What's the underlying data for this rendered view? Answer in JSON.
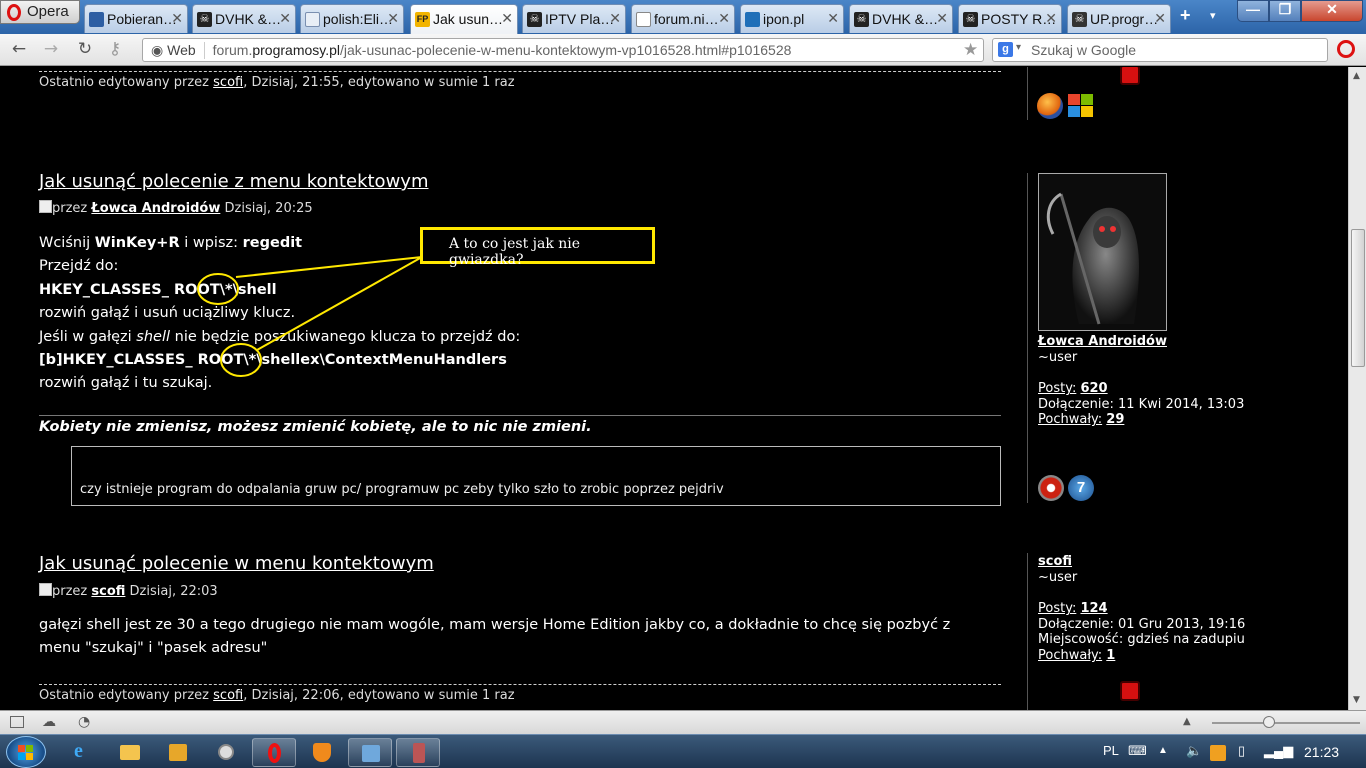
{
  "browser": {
    "menu_label": "Opera",
    "tabs": [
      {
        "label": "Pobieran…"
      },
      {
        "label": "DVHK &…"
      },
      {
        "label": "polish:Eli…"
      },
      {
        "label": "Jak usun…"
      },
      {
        "label": "IPTV Pla…"
      },
      {
        "label": "forum.ni…"
      },
      {
        "label": "ipon.pl"
      },
      {
        "label": "DVHK &…"
      },
      {
        "label": "POSTY R…"
      },
      {
        "label": "UP.progr…"
      }
    ],
    "address": {
      "badge": "Web",
      "url_prefix": "forum.",
      "url_domain": "programosy.pl",
      "url_path": "/jak-usunac-polecenie-w-menu-kontektowym-vp1016528.html#p1016528"
    },
    "search_placeholder": "Szukaj w Google"
  },
  "posts": [
    {
      "edited_prefix": "Ostatnio edytowany przez",
      "edited_user": "scofi",
      "edited_suffix": ", Dzisiaj, 21:55, edytowano w sumie 1 raz"
    },
    {
      "title": "Jak usunąć polecenie z menu kontektowym",
      "by": "przez",
      "author": "Łowca Androidów",
      "date": "Dzisiaj, 20:25",
      "lines": {
        "l1a": "Wciśnij ",
        "l1b": "WinKey+R",
        "l1c": " i wpisz: ",
        "l1d": "regedit",
        "l2": "Przejdź do:",
        "l3": "HKEY_CLASSES_ ROOT\\*\\shell",
        "l4": "rozwiń gałąź i usuń uciążliwy klucz.",
        "l5a": "Jeśli w gałęzi ",
        "l5b": "shell",
        "l5c": " nie będzie poszukiwanego klucza to przejdź do:",
        "l6": "[b]HKEY_CLASSES_ ROOT\\*\\shellex\\ContextMenuHandlers",
        "l7": "rozwiń gałąź i tu szukaj."
      },
      "signature": "Kobiety nie zmienisz, możesz zmienić kobietę, ale to nic nie zmieni.",
      "quote": "czy istnieje program do odpalania gruw pc/ programuw pc zeby tylko szło to zrobic poprzez pejdriv",
      "annotation": "A to co jest jak nie gwiazdka?",
      "sidebar": {
        "username": "Łowca Androidów",
        "rank": "~user",
        "posts_label": "Posty:",
        "posts": "620",
        "joined": "Dołączenie: 11 Kwi 2014, 13:03",
        "praise_label": "Pochwały:",
        "praise": "29"
      }
    },
    {
      "title": "Jak usunąć polecenie w menu kontektowym",
      "by": "przez",
      "author": "scofi",
      "date": "Dzisiaj, 22:03",
      "body1": "gałęzi shell jest ze 30 a tego drugiego nie mam wogóle, mam wersje Home Edition jakby co, a dokładnie to chcę się pozbyć z",
      "body2": "menu \"szukaj\" i \"pasek adresu\"",
      "edited_prefix": "Ostatnio edytowany przez",
      "edited_user": "scofi",
      "edited_suffix": ", Dzisiaj, 22:06, edytowano w sumie 1 raz",
      "sidebar": {
        "username": "scofi",
        "rank": "~user",
        "posts_label": "Posty:",
        "posts": "124",
        "joined": "Dołączenie: 01 Gru 2013, 19:16",
        "location": "Miejscowość: gdzieś na zadupiu",
        "praise_label": "Pochwały:",
        "praise": "1"
      }
    }
  ],
  "taskbar": {
    "language": "PL",
    "clock": "21:23"
  },
  "colors": {
    "annotation": "#ffe800",
    "rosette": "#d61010",
    "page_bg": "#000000"
  }
}
